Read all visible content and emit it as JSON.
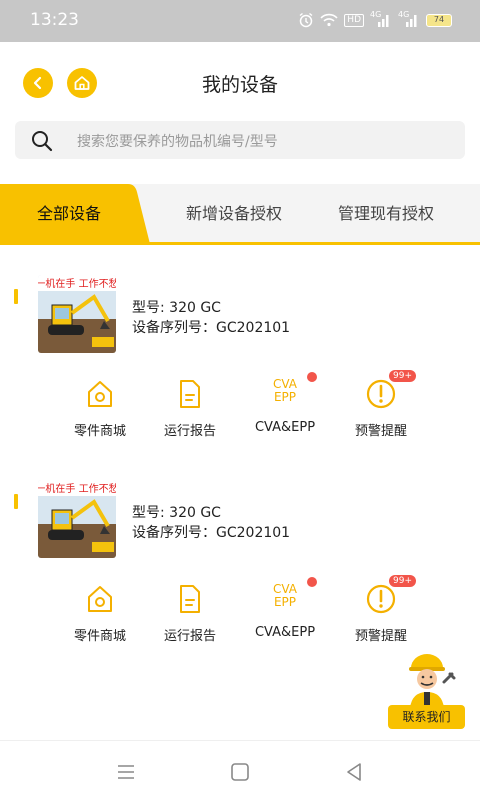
{
  "status_bar": {
    "time": "13:23",
    "hd_label": "HD",
    "net1": "4G",
    "net2": "4G",
    "battery": "74"
  },
  "header": {
    "title": "我的设备"
  },
  "search": {
    "placeholder": "搜索您要保养的物品机编号/型号"
  },
  "tabs": [
    {
      "label": "全部设备",
      "active": true
    },
    {
      "label": "新增设备授权",
      "active": false
    },
    {
      "label": "管理现有授权",
      "active": false
    }
  ],
  "devices": [
    {
      "thumb_text": "一机在手 工作不愁",
      "model": "型号: 320 GC",
      "serial": "设备序列号：GC202101",
      "actions": {
        "parts": "零件商城",
        "report": "运行报告",
        "cva": "CVA&EPP",
        "cva_icon_top": "CVA",
        "cva_icon_bottom": "EPP",
        "alert": "预警提醒",
        "alert_badge": "99+"
      }
    },
    {
      "thumb_text": "一机在手 工作不愁",
      "model": "型号: 320 GC",
      "serial": "设备序列号：GC202101",
      "actions": {
        "parts": "零件商城",
        "report": "运行报告",
        "cva": "CVA&EPP",
        "cva_icon_top": "CVA",
        "cva_icon_bottom": "EPP",
        "alert": "预警提醒",
        "alert_badge": "99+"
      }
    }
  ],
  "contact": {
    "label": "联系我们"
  },
  "colors": {
    "accent": "#f8c100",
    "badge": "#f2554a",
    "status_bar": "#c7c7c7"
  }
}
